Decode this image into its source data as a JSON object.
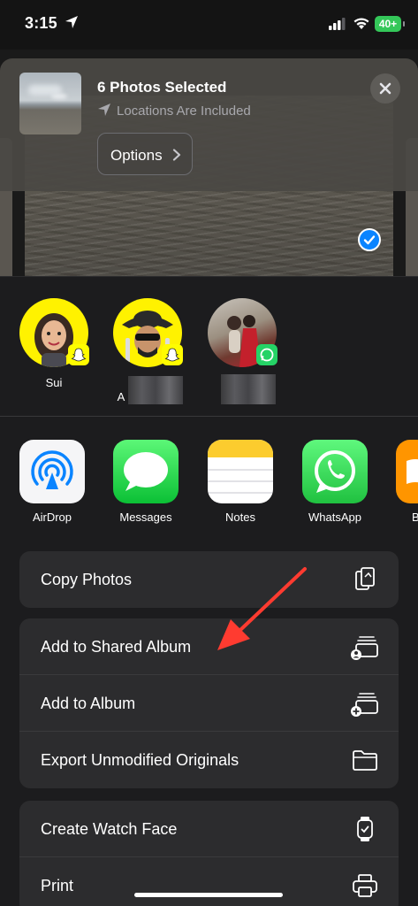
{
  "status_bar": {
    "time": "3:15",
    "battery": "40+"
  },
  "header": {
    "title": "6 Photos Selected",
    "subtitle": "Locations Are Included",
    "options_label": "Options"
  },
  "contacts": [
    {
      "name": "Sui",
      "app": "snapchat"
    },
    {
      "name": "A",
      "app": "snapchat"
    },
    {
      "name": "",
      "app": "whatsapp"
    }
  ],
  "apps": [
    {
      "label": "AirDrop"
    },
    {
      "label": "Messages"
    },
    {
      "label": "Notes"
    },
    {
      "label": "WhatsApp"
    },
    {
      "label": "B"
    }
  ],
  "actions": {
    "group1": [
      {
        "label": "Copy Photos",
        "icon": "copy-photos-icon"
      }
    ],
    "group2": [
      {
        "label": "Add to Shared Album",
        "icon": "shared-album-icon"
      },
      {
        "label": "Add to Album",
        "icon": "add-album-icon"
      },
      {
        "label": "Export Unmodified Originals",
        "icon": "folder-icon"
      }
    ],
    "group3": [
      {
        "label": "Create Watch Face",
        "icon": "watch-icon"
      },
      {
        "label": "Print",
        "icon": "printer-icon"
      }
    ]
  },
  "colors": {
    "accent": "#0a84ff",
    "annotation_arrow": "#ff3b30",
    "sheet_bg": "#1c1c1e",
    "row_bg": "#2c2c2e"
  }
}
